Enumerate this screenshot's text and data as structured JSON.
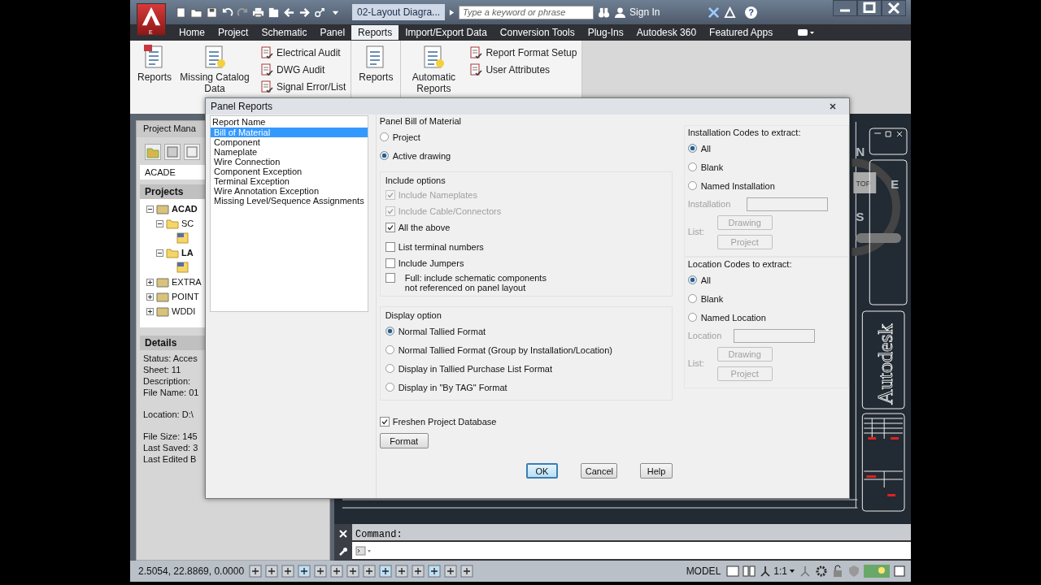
{
  "title_bar": {
    "app_badge": "E",
    "document_title": "02-Layout Diagra...",
    "search": {
      "placeholder": "Type a keyword or phrase"
    },
    "sign_in": "Sign In",
    "help": "?"
  },
  "ribbon": {
    "tabs": [
      {
        "label": "Home",
        "selected": false
      },
      {
        "label": "Project",
        "selected": false
      },
      {
        "label": "Schematic",
        "selected": false
      },
      {
        "label": "Panel",
        "selected": false
      },
      {
        "label": "Reports",
        "selected": true
      },
      {
        "label": "Import/Export Data",
        "selected": false
      },
      {
        "label": "Conversion Tools",
        "selected": false
      },
      {
        "label": "Plug-Ins",
        "selected": false
      },
      {
        "label": "Autodesk 360",
        "selected": false
      },
      {
        "label": "Featured Apps",
        "selected": false
      }
    ],
    "groups": [
      {
        "tools": [
          {
            "label": "Reports",
            "kind": "large"
          },
          {
            "label": "Missing Catalog Data",
            "kind": "large"
          },
          {
            "label": "Electrical Audit",
            "kind": "small"
          },
          {
            "label": "DWG Audit",
            "kind": "small"
          },
          {
            "label": "Signal Error/List",
            "kind": "small"
          }
        ]
      },
      {
        "tools": [
          {
            "label": "Reports",
            "kind": "large"
          }
        ]
      },
      {
        "tools": [
          {
            "label": "Automatic Reports",
            "kind": "large"
          },
          {
            "label": "Report Format Setup",
            "kind": "small"
          },
          {
            "label": "User Attributes",
            "kind": "small"
          }
        ]
      }
    ]
  },
  "project_manager": {
    "title": "Project Mana",
    "project_field": "ACADE",
    "projects_header": "Projects",
    "tree": [
      {
        "label": "ACAD",
        "kind": "project",
        "active": true,
        "expanded": true,
        "children": [
          {
            "label": "SC",
            "kind": "folder",
            "active": false,
            "expanded": true,
            "children": [
              {
                "kind": "drawing"
              }
            ]
          },
          {
            "label": "LA",
            "kind": "folder",
            "active": true,
            "expanded": true,
            "children": [
              {
                "kind": "drawing"
              }
            ]
          }
        ]
      },
      {
        "label": "EXTRA",
        "kind": "project",
        "active": false,
        "expanded": false
      },
      {
        "label": "POINT",
        "kind": "project",
        "active": false,
        "expanded": false
      },
      {
        "label": "WDDI",
        "kind": "project",
        "active": false,
        "expanded": false
      }
    ],
    "details_header": "Details",
    "details": [
      [
        "Status: Acces",
        "Sheet: 11",
        "Description:",
        "File Name: 01"
      ],
      [
        "Location: D:\\"
      ],
      [
        "File Size: 145",
        "Last Saved: 3",
        "Last Edited B"
      ]
    ]
  },
  "canvas": {
    "viewcube": {
      "north": "N",
      "east": "E",
      "south": "S",
      "face": "TOP"
    },
    "title_block": "Autodesk"
  },
  "command_line": {
    "prompt": "Command:"
  },
  "status_bar": {
    "coordinates": "2.5054, 22.8869, 0.0000",
    "space": "MODEL",
    "scale": "1:1"
  },
  "dialog": {
    "title": "Panel Reports",
    "report_list": {
      "header": "Report Name",
      "items": [
        {
          "label": "Bill of Material",
          "selected": true
        },
        {
          "label": "Component",
          "selected": false
        },
        {
          "label": "Nameplate",
          "selected": false
        },
        {
          "label": "Wire Connection",
          "selected": false
        },
        {
          "label": "Component Exception",
          "selected": false
        },
        {
          "label": "Terminal Exception",
          "selected": false
        },
        {
          "label": "Wire Annotation Exception",
          "selected": false
        },
        {
          "label": "Missing Level/Sequence Assignments",
          "selected": false
        }
      ]
    },
    "scope": {
      "title": "Panel Bill of Material",
      "options": [
        {
          "label": "Project",
          "selected": false
        },
        {
          "label": "Active drawing",
          "selected": true
        }
      ]
    },
    "include_options": {
      "title": "Include options",
      "items": [
        {
          "label": "Include Nameplates",
          "checked": true,
          "disabled": true
        },
        {
          "label": "Include Cable/Connectors",
          "checked": true,
          "disabled": true
        },
        {
          "label": "All the above",
          "checked": true,
          "disabled": false
        },
        {
          "label": "List terminal numbers",
          "checked": false,
          "disabled": false
        },
        {
          "label": "Include Jumpers",
          "checked": false,
          "disabled": false
        },
        {
          "label": "Full: include schematic components\nnot referenced on panel layout",
          "checked": false,
          "disabled": false
        }
      ]
    },
    "display_option": {
      "title": "Display option",
      "options": [
        {
          "label": "Normal Tallied Format",
          "selected": true
        },
        {
          "label": "Normal Tallied Format (Group by Installation/Location)",
          "selected": false
        },
        {
          "label": "Display in Tallied Purchase List Format",
          "selected": false
        },
        {
          "label": "Display in \"By TAG\" Format",
          "selected": false
        }
      ]
    },
    "freshen": {
      "label": "Freshen Project Database",
      "checked": true
    },
    "format_button": "Format",
    "codes": [
      {
        "title": "Installation Codes to extract:",
        "options": [
          {
            "label": "All",
            "selected": true
          },
          {
            "label": "Blank",
            "selected": false
          },
          {
            "label": "Named Installation",
            "selected": false
          }
        ],
        "field_label": "Installation",
        "list_label": "List:",
        "buttons": [
          "Drawing",
          "Project"
        ],
        "disabled": true
      },
      {
        "title": "Location Codes to extract:",
        "options": [
          {
            "label": "All",
            "selected": true
          },
          {
            "label": "Blank",
            "selected": false
          },
          {
            "label": "Named Location",
            "selected": false
          }
        ],
        "field_label": "Location",
        "list_label": "List:",
        "buttons": [
          "Drawing",
          "Project"
        ],
        "disabled": true
      }
    ],
    "buttons": [
      {
        "label": "OK",
        "default": true
      },
      {
        "label": "Cancel",
        "default": false
      },
      {
        "label": "Help",
        "default": false
      }
    ]
  }
}
